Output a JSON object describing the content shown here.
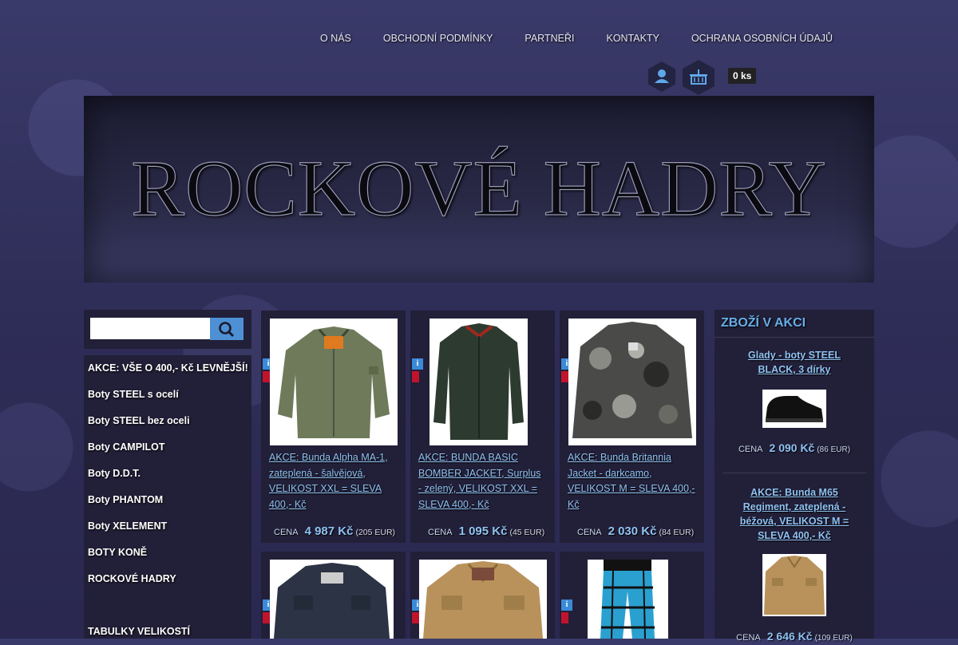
{
  "nav": [
    "O NÁS",
    "OBCHODNÍ PODMÍNKY",
    "PARTNEŘI",
    "KONTAKTY",
    "OCHRANA OSOBNÍCH ÚDAJŮ"
  ],
  "cart": {
    "count": "0 ks",
    "icon": "basket-icon",
    "user_icon": "user-icon"
  },
  "banner": {
    "title": "ROCKOVÉ HADRY"
  },
  "search": {
    "placeholder": "",
    "icon": "search-icon"
  },
  "sidebar": {
    "items": [
      "AKCE: VŠE O 400,- Kč LEVNĚJŠÍ!",
      "Boty STEEL s ocelí",
      "Boty STEEL bez oceli",
      "Boty CAMPILOT",
      "Boty D.D.T.",
      "Boty PHANTOM",
      "Boty XELEMENT",
      "BOTY KONĚ",
      "ROCKOVÉ HADRY",
      "TABULKY VELIKOSTÍ"
    ]
  },
  "products": [
    {
      "name": "AKCE: Bunda Alpha MA-1, zateplená - šalvějová, VELIKOST XXL = SLEVA 400,- Kč",
      "price_label": "CENA",
      "price": "4 987 Kč",
      "eur": "(205 EUR)"
    },
    {
      "name": "AKCE: BUNDA BASIC BOMBER JACKET, Surplus - zelený, VELIKOST XXL = SLEVA 400,- Kč",
      "price_label": "CENA",
      "price": "1 095 Kč",
      "eur": "(45 EUR)"
    },
    {
      "name": "AKCE: Bunda Britannia Jacket - darkcamo, VELIKOST M = SLEVA 400,- Kč",
      "price_label": "CENA",
      "price": "2 030 Kč",
      "eur": "(84 EUR)"
    },
    {
      "name": ""
    },
    {
      "name": ""
    },
    {
      "name": ""
    }
  ],
  "badges": {
    "info": "i"
  },
  "sale": {
    "title": "ZBOŽÍ V AKCI",
    "items": [
      {
        "name": "Glady - boty STEEL BLACK, 3 dírky",
        "price_label": "CENA",
        "price": "2 090 Kč",
        "eur": "(86 EUR)"
      },
      {
        "name": "AKCE: Bunda M65 Regiment, zateplená - béžová, VELIKOST M = SLEVA 400,- Kč",
        "price_label": "CENA",
        "price": "2 646 Kč",
        "eur": "(109 EUR)"
      }
    ]
  },
  "colors": {
    "accent": "#4d91d4",
    "link": "#8fc3f3",
    "panel": "#221f38",
    "sale_red": "#c0142c"
  }
}
